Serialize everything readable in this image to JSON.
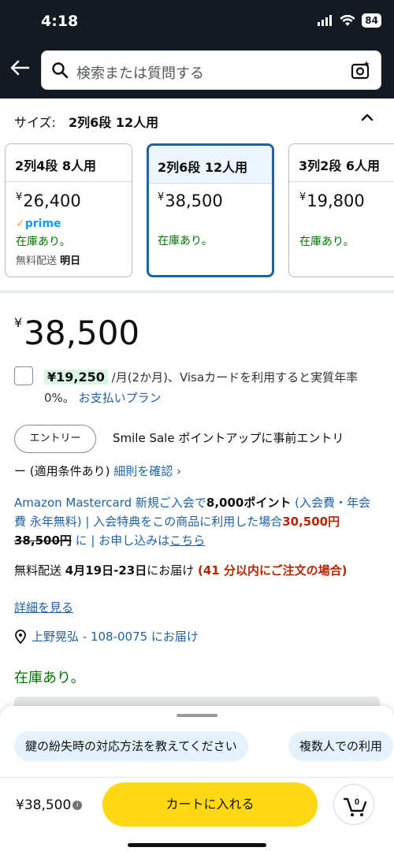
{
  "status_bar": {
    "time": "4:18",
    "battery": "84"
  },
  "search": {
    "placeholder": "検索または質問する"
  },
  "size": {
    "label": "サイズ:",
    "value": "2列6段 12人用"
  },
  "variants": [
    {
      "name": "2列4段 8人用",
      "price": "26,400",
      "prime": "prime",
      "stock": "在庫あり。",
      "ship_label": "無料配送",
      "ship_date": "明日"
    },
    {
      "name": "2列6段 12人用",
      "price": "38,500",
      "stock": "在庫あり。"
    },
    {
      "name": "3列2段 6人用",
      "price": "19,800",
      "stock": "在庫あり。"
    }
  ],
  "currency": "¥",
  "main_price": "38,500",
  "installment": {
    "amount": "¥19,250",
    "text": "/月(2か月)、Visaカードを利用すると実質年率0%。",
    "link": "お支払いプラン"
  },
  "entry": {
    "button": "エントリー",
    "text_line1": "Smile Sale ポイントアップに事前エントリ",
    "text_line2": "ー (適用条件あり)",
    "link": "細則を確認 ›"
  },
  "mastercard": {
    "text1": "Amazon Mastercard 新規ご入会で",
    "points": "8,000ポイント",
    "text2": " (入会費・年会費 永年無料) | 入会特典をこの商品に利用した場合",
    "new_price": "30,500円",
    "old_price": "38,500円",
    "text3": " に | お申し込みは",
    "link": "こちら"
  },
  "delivery": {
    "label": "無料配送",
    "dates": "4月19日-23日",
    "suffix": "にお届け",
    "urgency": "(41 分以内にご注文の場合)",
    "details_link": "詳細を見る"
  },
  "location": "上野晃弘 - 108-0075 にお届け",
  "in_stock": "在庫あり。",
  "suggestions": [
    "鍵の紛失時の対応方法を教えてください",
    "複数人での利用"
  ],
  "bottom": {
    "price": "¥38,500",
    "cart_button": "カートに入れる",
    "cart_count": "0"
  },
  "colors": {
    "dark_header": "#131a22",
    "link": "#2162a1",
    "stock_green": "#007600",
    "price_red": "#b12704",
    "cart_yellow": "#ffd814",
    "selected_border": "#2162a1"
  }
}
